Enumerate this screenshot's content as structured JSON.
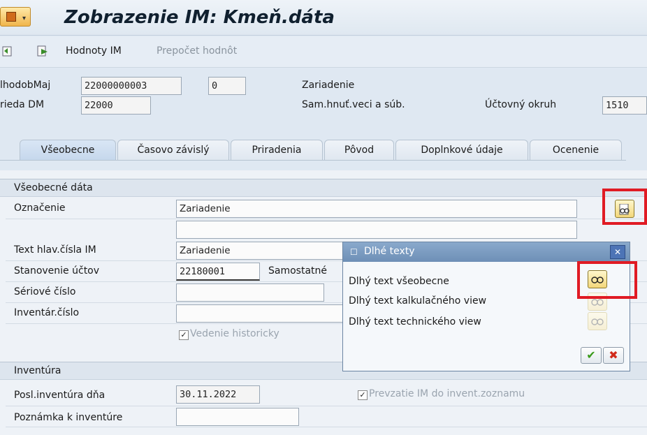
{
  "title": "Zobrazenie IM: Kmeň.dáta",
  "toolbar": {
    "hodnoty": "Hodnoty IM",
    "prepocet": "Prepočet hodnôt"
  },
  "header": {
    "label_hodob": "lhodobMaj",
    "value_hodob": "22000000003",
    "value_sub": "0",
    "desc1": "Zariadenie",
    "label_trieda": "rieda DM",
    "value_trieda": "22000",
    "desc2": "Sam.hnuť.veci a súb.",
    "label_okruh": "Účtovný okruh",
    "value_okruh": "1510"
  },
  "tabs": [
    {
      "label": "Všeobecne"
    },
    {
      "label": "Časovo závislý"
    },
    {
      "label": "Priradenia"
    },
    {
      "label": "Pôvod"
    },
    {
      "label": "Doplnkové údaje"
    },
    {
      "label": "Ocenenie"
    }
  ],
  "general": {
    "heading": "Všeobecné dáta",
    "oznacenie_label": "Označenie",
    "oznacenie_value": "Zariadenie",
    "oznacenie_value2": "",
    "text_label": "Text hlav.čísla IM",
    "text_value": "Zariadenie",
    "ucet_label": "Stanovenie účtov",
    "ucet_value": "22180001",
    "ucet_desc": "Samostatné",
    "serial_label": "Sériové číslo",
    "serial_value": "",
    "inv_label": "Inventár.číslo",
    "inv_value": "",
    "history_label": "Vedenie historicky",
    "history_checked": "✓"
  },
  "inventura": {
    "heading": "Inventúra",
    "posl_label": "Posl.inventúra dňa",
    "posl_value": "30.11.2022",
    "prevzatie_label": "Prevzatie IM do invent.zoznamu",
    "prevzatie_checked": "✓",
    "poznamka_label": "Poznámka k inventúre",
    "poznamka_value": ""
  },
  "popup": {
    "title": "Dlhé texty",
    "lines": [
      "Dlhý text všeobecne",
      "Dlhý text kalkulačného view",
      "Dlhý text technického view"
    ],
    "ok": "✔",
    "cancel": "✖",
    "close": "✕"
  },
  "colors": {
    "highlight": "#e01b24",
    "popup_title": "#6e8fb6"
  }
}
